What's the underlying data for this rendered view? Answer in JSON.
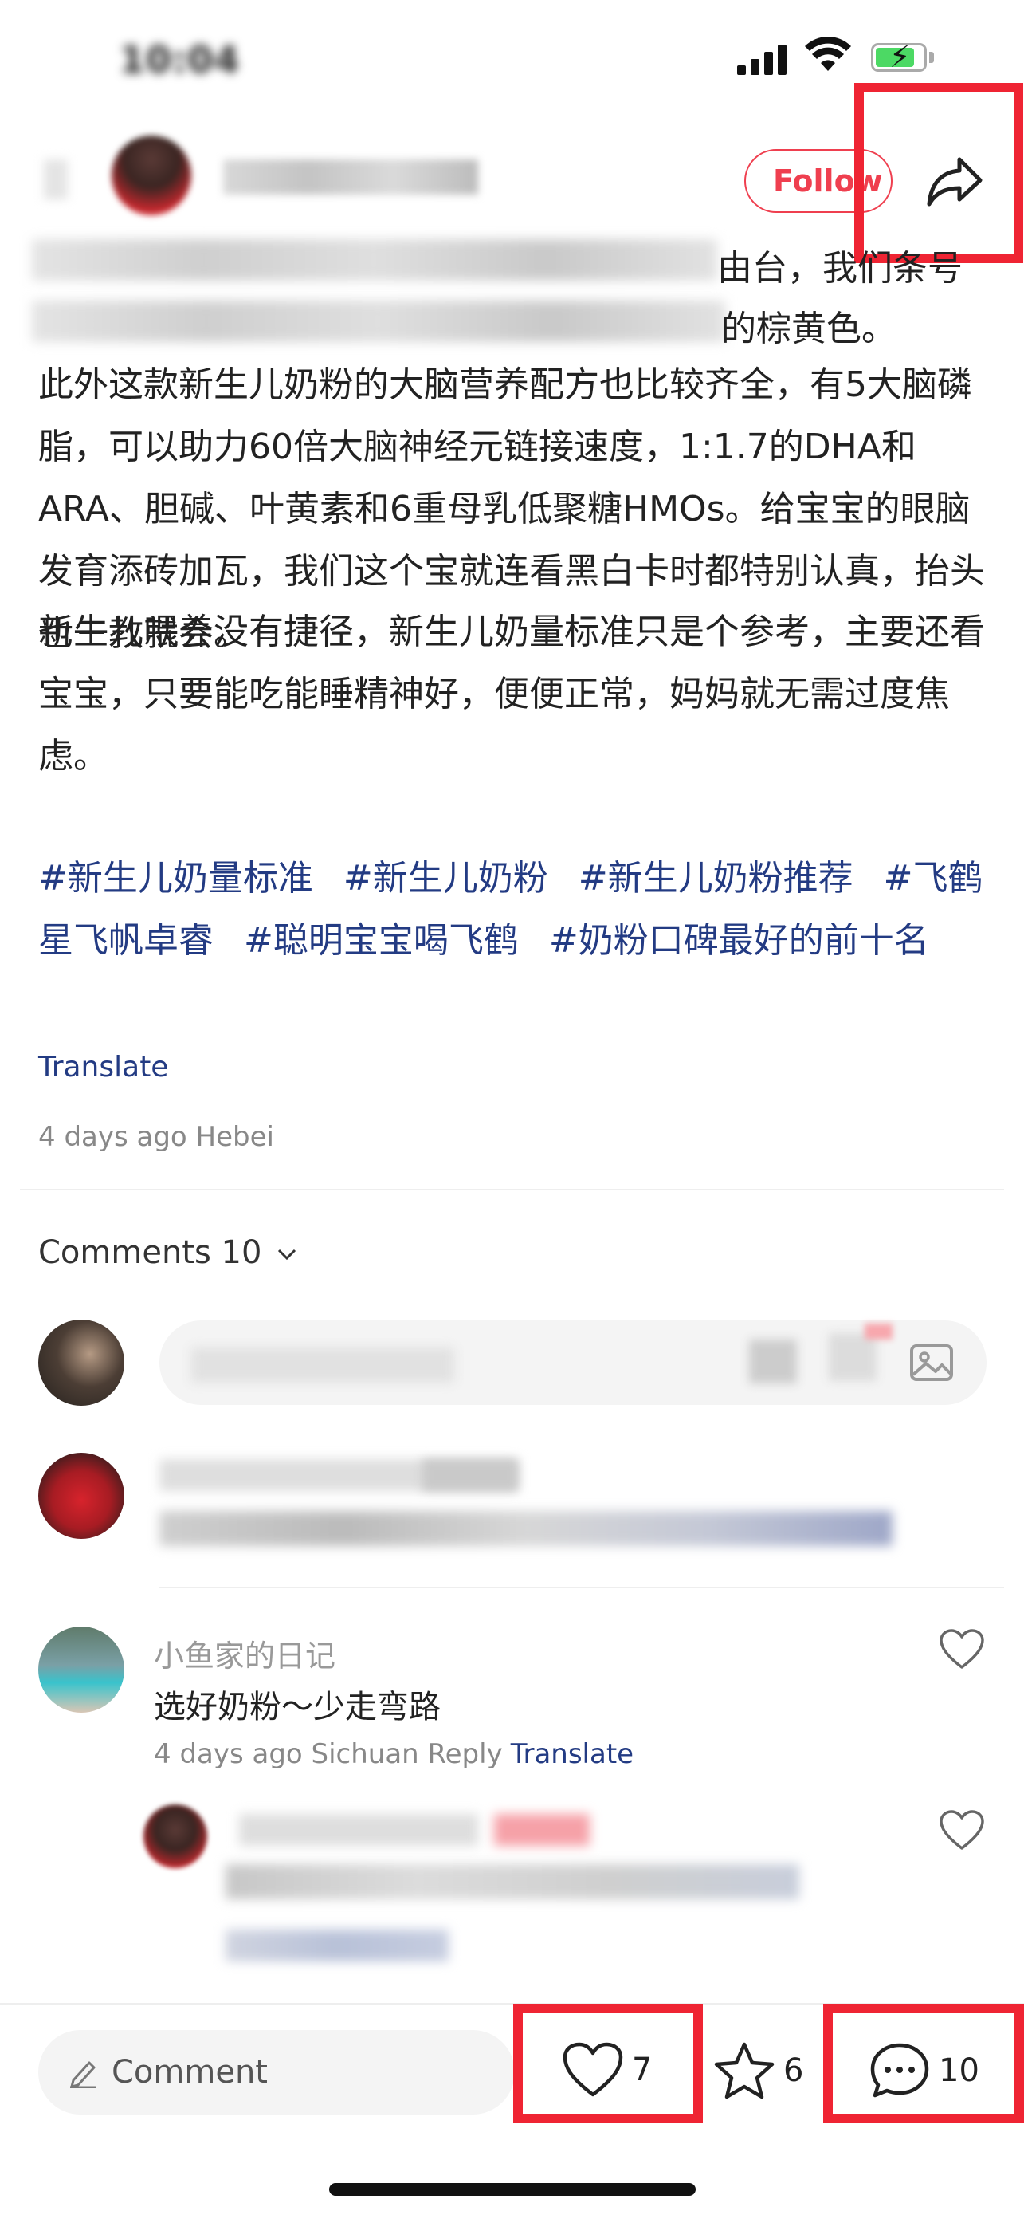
{
  "status_bar": {
    "time": "10:04"
  },
  "header": {
    "follow_label": "Follow"
  },
  "post": {
    "line2_tail": "由台，我们条号",
    "line3_tail": "的棕黄色。",
    "paragraphs": [
      "此外这款新生儿奶粉的大脑营养配方也比较齐全，有5大脑磷脂，可以助力60倍大脑神经元链接速度，1:1.7的DHA和ARA、胆碱、叶黄素和6重母乳低聚糖HMOs。给宝宝的眼脑发育添砖加瓦，我们这个宝就连看黑白卡时都特别认真，抬头也一教就会。",
      "新生儿喂养没有捷径，新生儿奶量标准只是个参考，主要还看宝宝，只要能吃能睡精神好，便便正常，妈妈就无需过度焦虑。"
    ],
    "tags": [
      "#新生儿奶量标准",
      "#新生儿奶粉",
      "#新生儿奶粉推荐",
      "#飞鹤星飞帆卓睿",
      "#聪明宝宝喝飞鹤",
      "#奶粉口碑最好的前十名"
    ],
    "translate_label": "Translate",
    "meta": "4 days ago Hebei"
  },
  "comments": {
    "title": "Comments 10",
    "items": [
      {
        "username": "小鱼家的日记",
        "text": "选好奶粉～少走弯路",
        "meta": "4 days ago Sichuan Reply",
        "translate": "Translate"
      }
    ]
  },
  "bottom_bar": {
    "comment_placeholder": "Comment",
    "likes": "7",
    "stars": "6",
    "comments": "10"
  },
  "colors": {
    "accent": "#ef3f4f",
    "link": "#233b83",
    "highlight_box": "#ef2433"
  },
  "icons": [
    "share-icon",
    "heart-icon",
    "star-icon",
    "chat-bubble-icon",
    "pencil-icon",
    "image-icon",
    "chevron-down-icon"
  ]
}
